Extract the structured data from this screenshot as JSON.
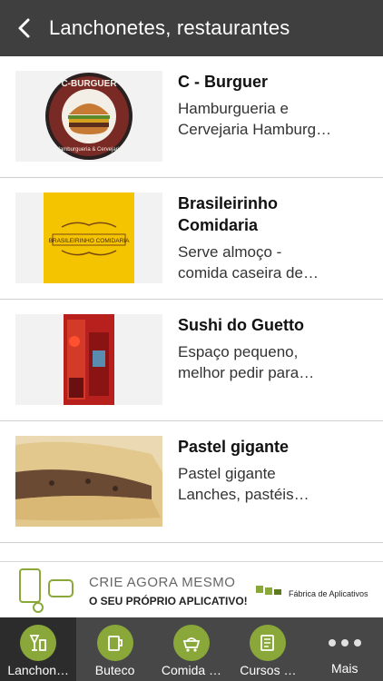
{
  "header": {
    "title": "Lanchonetes, restaurantes"
  },
  "items": [
    {
      "title": "C - Burguer",
      "desc_line1": "Hamburgueria e",
      "desc_line2": "Cervejaria Hamburg…",
      "logo_top": "C-BURGUER",
      "logo_bottom": "Hamburgueria & Cervejaria"
    },
    {
      "title_line1": "Brasileirinho",
      "title_line2": "Comidaria",
      "desc_line1": "Serve almoço -",
      "desc_line2": "comida caseira de…",
      "logo_text": "BRASILEIRINHO COMIDARIA"
    },
    {
      "title": "Sushi do Guetto",
      "desc_line1": "Espaço pequeno,",
      "desc_line2": "melhor pedir para…"
    },
    {
      "title": "Pastel gigante",
      "desc_line1": "Pastel gigante",
      "desc_line2": "Lanches, pastéis…"
    }
  ],
  "ad": {
    "line1": "CRIE AGORA MESMO",
    "line2": "O SEU PRÓPRIO APLICATIVO!",
    "brand": "Fábrica de Aplicativos"
  },
  "tabs": [
    {
      "label": "Lanchon…",
      "icon": "drinks-icon"
    },
    {
      "label": "Buteco",
      "icon": "beer-mug-icon"
    },
    {
      "label": "Comida …",
      "icon": "food-cart-icon"
    },
    {
      "label": "Cursos …",
      "icon": "notebook-icon"
    },
    {
      "label": "Mais",
      "icon": "more-dots-icon"
    }
  ],
  "colors": {
    "header_bg": "#3f3f3f",
    "tab_bg": "#474747",
    "tab_icon_green": "#8aa83a"
  }
}
